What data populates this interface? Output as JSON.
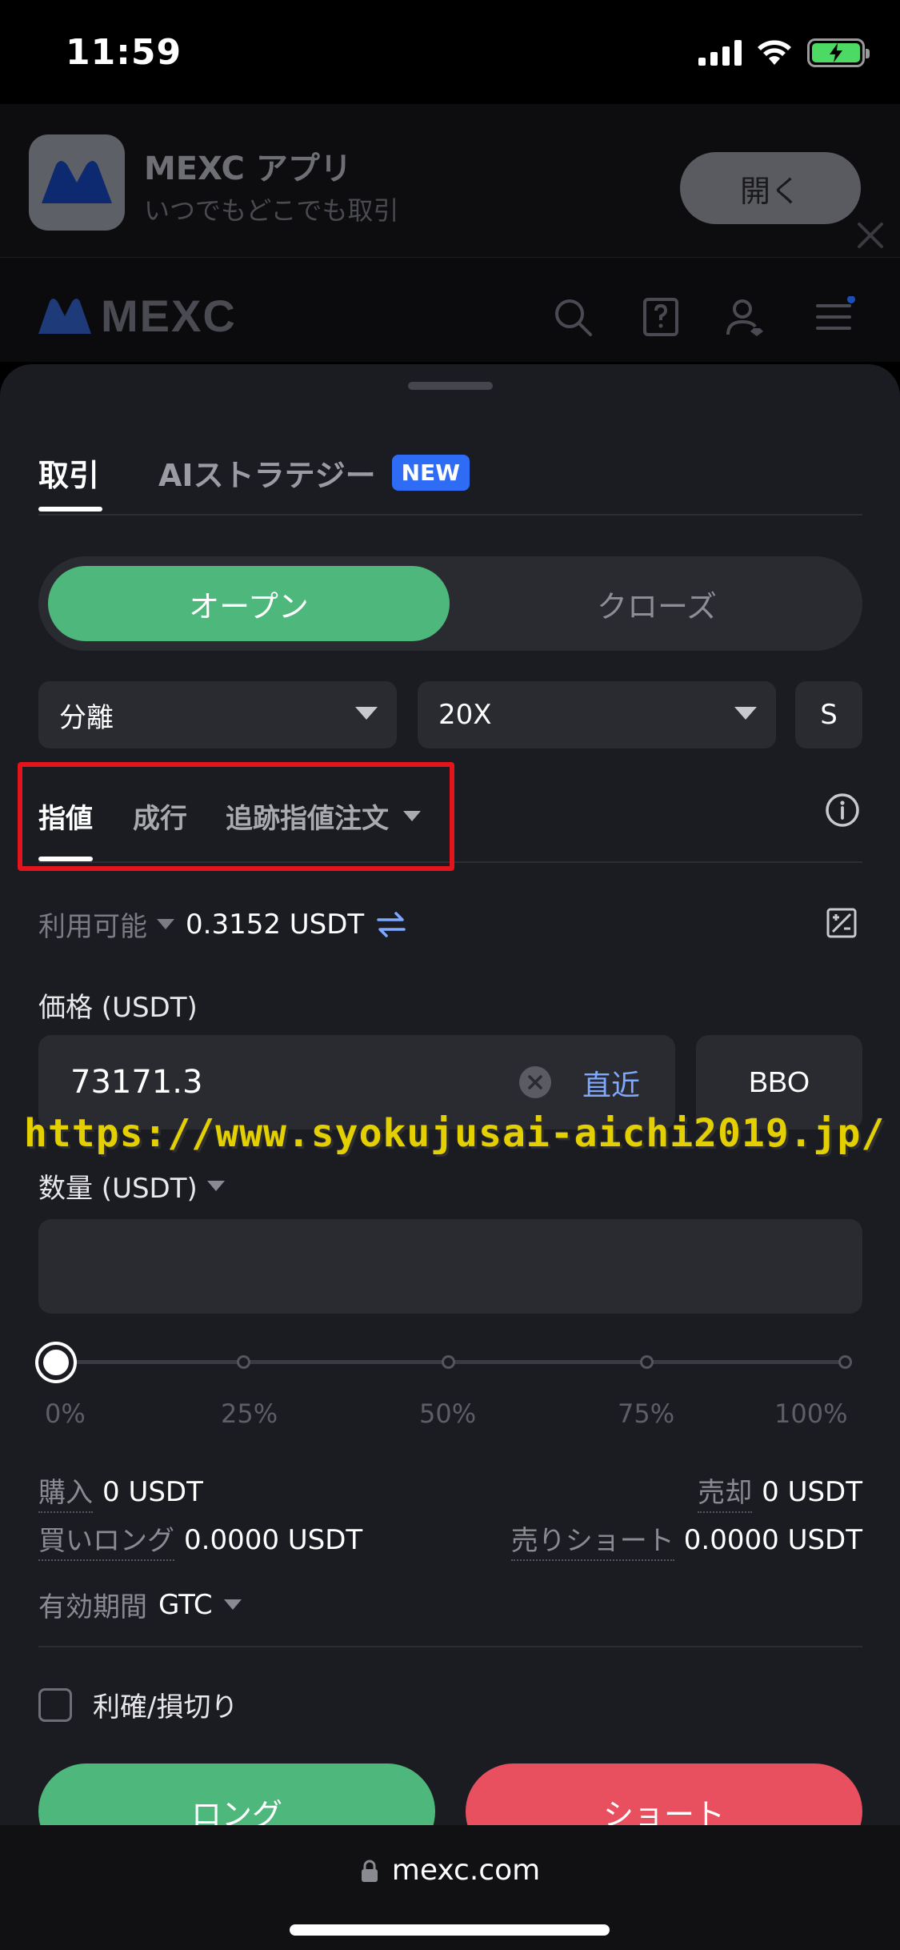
{
  "status_bar": {
    "time": "11:59"
  },
  "app_banner": {
    "name": "MEXC アプリ",
    "subtitle": "いつでもどこでも取引",
    "open_label": "開く"
  },
  "header": {
    "logo_text": "MEXC"
  },
  "trade_panel": {
    "tabs": {
      "trade": "取引",
      "ai_strategy": "AIストラテジー",
      "new_badge": "NEW"
    },
    "position_toggle": {
      "open": "オープン",
      "close": "クローズ"
    },
    "margin_mode": "分離",
    "leverage": "20X",
    "size_mode": "S",
    "order_types": {
      "limit": "指値",
      "market": "成行",
      "trailing": "追跡指値注文"
    },
    "available": {
      "label": "利用可能",
      "value": "0.3152 USDT"
    },
    "price": {
      "label": "価格 (USDT)",
      "value": "73171.3",
      "recent": "直近",
      "bbo": "BBO"
    },
    "quantity": {
      "label": "数量 (USDT)",
      "value": ""
    },
    "slider": {
      "labels": [
        "0%",
        "25%",
        "50%",
        "75%",
        "100%"
      ],
      "value_percent": 0
    },
    "stats": {
      "buy_label": "購入",
      "buy_value": "0 USDT",
      "sell_label": "売却",
      "sell_value": "0 USDT",
      "long_label": "買いロング",
      "long_value": "0.0000 USDT",
      "short_label": "売りショート",
      "short_value": "0.0000 USDT"
    },
    "validity": {
      "label": "有効期間",
      "value": "GTC"
    },
    "tpsl_label": "利確/損切り",
    "long_button": "ロング",
    "short_button": "ショート"
  },
  "watermark": "https://www.syokujusai-aichi2019.jp/",
  "browser": {
    "url": "mexc.com"
  },
  "colors": {
    "accent_green": "#4eb77b",
    "accent_red": "#e8505f",
    "link_blue": "#7ea9ff",
    "highlight_red": "#e3141b"
  }
}
